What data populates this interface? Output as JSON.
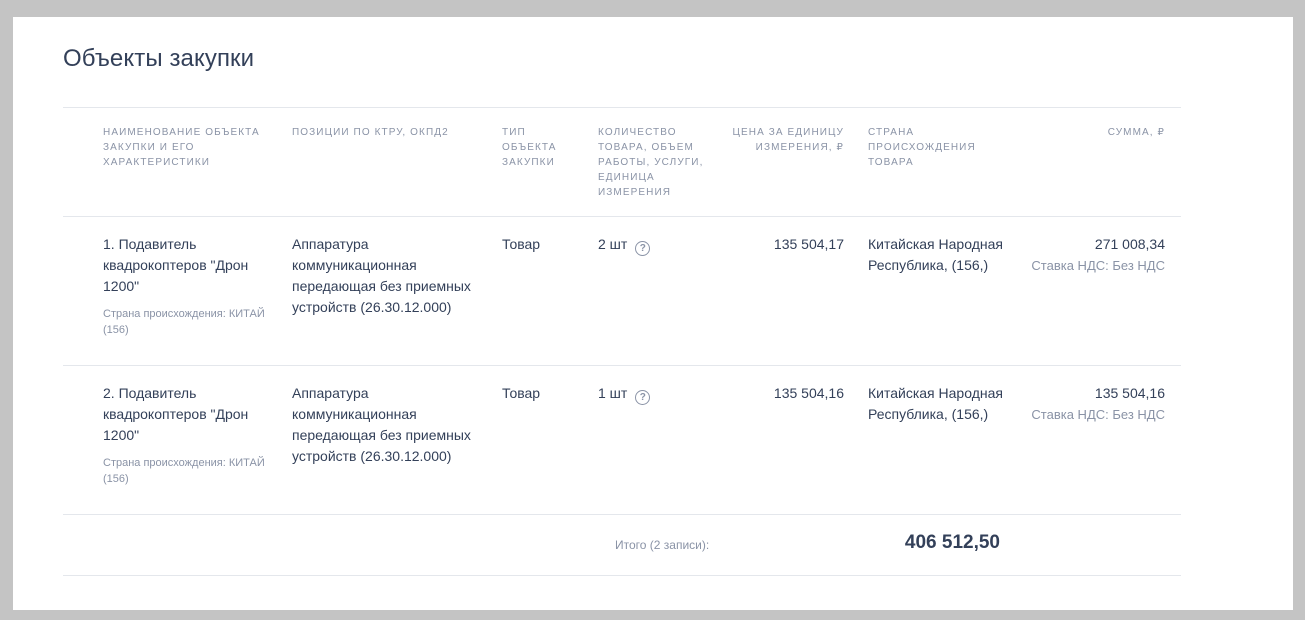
{
  "title": "Объекты закупки",
  "columns": {
    "name": "Наименование объекта закупки и его характеристики",
    "positions": "Позиции по КТРУ, ОКПД2",
    "type": "Тип объекта закупки",
    "quantity": "Количество товара, объем работы, услуги, единица измерения",
    "price": "Цена за единицу измерения, ₽",
    "country": "Страна происхождения товара",
    "sum": "Сумма, ₽"
  },
  "rows": [
    {
      "name": "1. Подавитель квадрокоптеров \"Дрон 1200\"",
      "origin": "Страна происхождения: КИТАЙ (156)",
      "positions": "Аппаратура коммуникационная передающая без приемных устройств (26.30.12.000)",
      "type": "Товар",
      "quantity": "2 шт",
      "price": "135 504,17",
      "country": "Китайская Народная Республика, (156,)",
      "sum": "271 008,34",
      "vat": "Ставка НДС: Без НДС"
    },
    {
      "name": "2. Подавитель квадрокоптеров \"Дрон 1200\"",
      "origin": "Страна происхождения: КИТАЙ (156)",
      "positions": "Аппаратура коммуникационная передающая без приемных устройств (26.30.12.000)",
      "type": "Товар",
      "quantity": "1 шт",
      "price": "135 504,16",
      "country": "Китайская Народная Республика, (156,)",
      "sum": "135 504,16",
      "vat": "Ставка НДС: Без НДС"
    }
  ],
  "total": {
    "label": "Итого (2 записи):",
    "value": "406 512,50"
  },
  "icons": {
    "help": "question-circle-icon",
    "help_glyph": "?"
  }
}
